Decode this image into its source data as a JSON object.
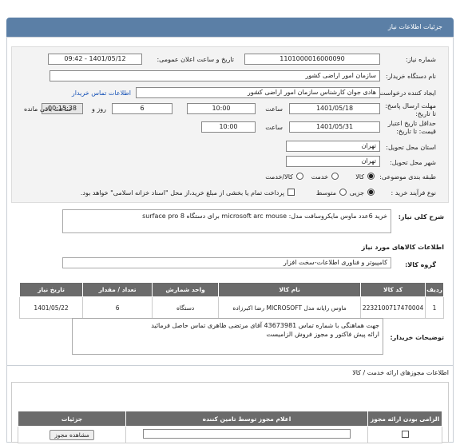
{
  "header": {
    "title": "جزئیات اطلاعات نیاز"
  },
  "fields": {
    "need_number_label": "شماره نیاز:",
    "need_number": "1101000016000090",
    "announce_label": "تاریخ و ساعت اعلان عمومی:",
    "announce_value": "1401/05/12 - 09:42",
    "buyer_label": "نام دستگاه خریدار:",
    "buyer_value": "سازمان امور اراضی کشور",
    "creator_label": "ایجاد کننده درخواست:",
    "creator_value": "هادی جوان کارشناس سازمان امور اراضی کشور",
    "contact_link": "اطلاعات تماس خریدار",
    "deadline_label": "مهلت ارسال پاسخ: تا تاریخ:",
    "deadline_date": "1401/05/18",
    "time_label": "ساعت",
    "deadline_time": "10:00",
    "days_value": "6",
    "days_label": "روز و",
    "remaining_value": "00:15:38",
    "remaining_label": "ساعت باقی مانده",
    "validity_label": "حداقل تاریخ اعتبار قیمت: تا تاریخ:",
    "validity_date": "1401/05/31",
    "validity_time": "10:00",
    "province_label": "استان محل تحویل:",
    "province_value": "تهران",
    "city_label": "شهر محل تحویل:",
    "city_value": "تهران",
    "category_label": "طبقه بندی موضوعی:",
    "cat_goods": "کالا",
    "cat_service": "خدمت",
    "cat_both": "کالا/خدمت",
    "process_label": "نوع فرآیند خرید :",
    "proc_partial": "جزیی",
    "proc_medium": "متوسط",
    "payment_note": "پرداخت تمام یا بخشی از مبلغ خرید،از محل \"اسناد خزانه اسلامی\" خواهد بود."
  },
  "description": {
    "label": "شرح کلی نیاز:",
    "value": "خرید 6عدد ماوس مایکروسافت مدل: microsoft arc mouse برای دستگاه surface pro 8"
  },
  "goods": {
    "section_title": "اطلاعات کالاهای مورد نیاز",
    "group_label": "گروه کالا:",
    "group_value": "کامپیوتر و فناوری اطلاعات-سخت افزار",
    "headers": [
      "ردیف",
      "کد کالا",
      "نام کالا",
      "واحد شمارش",
      "تعداد / مقدار",
      "تاریخ نیاز"
    ],
    "rows": [
      {
        "row": "1",
        "code": "2232100717470004",
        "name": "ماوس رایانه مدل MICROSOFT رضا اکبرزاده",
        "unit": "دستگاه",
        "qty": "6",
        "date": "1401/05/22"
      }
    ]
  },
  "buyer_notes": {
    "label": "توضیحات خریدار:",
    "line1": "جهت هماهنگی با شماره تماس 43673981 آقای مرتضی ظاهری تماس حاصل فرمائید",
    "line2": "ارائه پیش فاکتور و مجوز فروش الزامیست"
  },
  "services": {
    "title": "اطلاعات مجوزهای ارائه خدمت / کالا",
    "headers": [
      "الزامی بودن ارائه مجوز",
      "اعلام مجوز توسط تامین کننده",
      "جزئیات"
    ],
    "view_button": "مشاهده مجوز"
  },
  "colors": {
    "header_bg": "#5b7fa6",
    "table_header_bg": "#6b6b6b",
    "link": "#1a55b8"
  }
}
